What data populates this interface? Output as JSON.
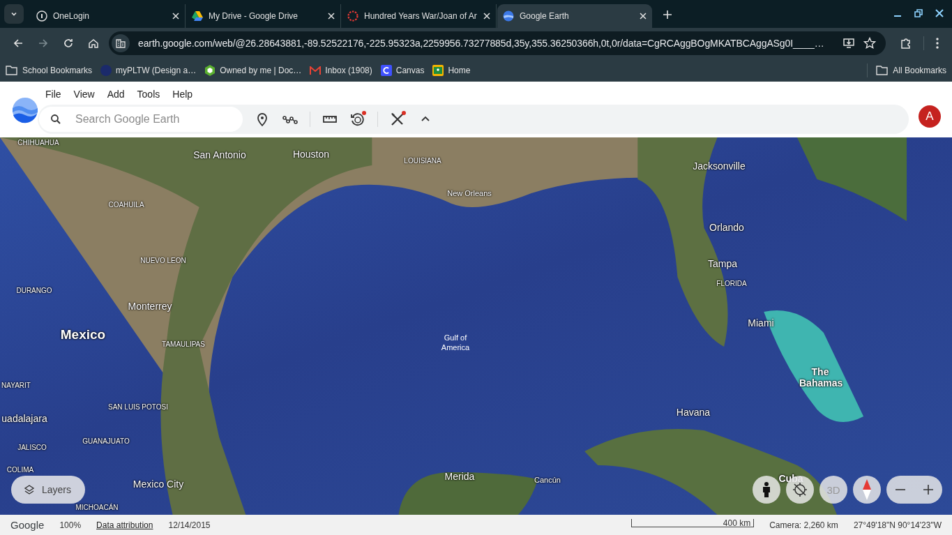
{
  "browser": {
    "tabs": [
      {
        "title": "OneLogin",
        "selected": false
      },
      {
        "title": "My Drive - Google Drive",
        "selected": false
      },
      {
        "title": "Hundred Years War/Joan of Ar",
        "selected": false
      },
      {
        "title": "Google Earth",
        "selected": true
      }
    ],
    "address": "earth.google.com/web/@26.28643881,-89.52522176,-225.95323a,2259956.73277885d,35y,355.36250366h,0t,0r/data=CgRCAggBOgMKATBCAggASg0I____…",
    "bookmarks": [
      {
        "title": "School Bookmarks"
      },
      {
        "title": "myPLTW (Design a…"
      },
      {
        "title": "Owned by me | Doc…"
      },
      {
        "title": "Inbox (1908)"
      },
      {
        "title": "Canvas"
      },
      {
        "title": "Home"
      }
    ],
    "all_bookmarks": "All Bookmarks"
  },
  "app": {
    "menu": [
      "File",
      "View",
      "Add",
      "Tools",
      "Help"
    ],
    "search": {
      "placeholder": "Search Google Earth"
    },
    "tools": [
      {
        "kind": "pin",
        "notification": false
      },
      {
        "kind": "path",
        "notification": false
      },
      {
        "kind": "ruler",
        "notification": false
      },
      {
        "kind": "history",
        "notification": true
      },
      {
        "kind": "tools",
        "notification": true
      },
      {
        "kind": "collapse",
        "notification": false
      }
    ],
    "avatar": "A"
  },
  "map": {
    "labels": [
      {
        "text": "CHIHUAHUA",
        "kind": "region"
      },
      {
        "text": "San Antonio",
        "kind": "city"
      },
      {
        "text": "Houston",
        "kind": "city"
      },
      {
        "text": "LOUISIANA",
        "kind": "region"
      },
      {
        "text": "Jacksonville",
        "kind": "city"
      },
      {
        "text": "COAHUILA",
        "kind": "region"
      },
      {
        "text": "New Orleans",
        "kind": "small"
      },
      {
        "text": "Orlando",
        "kind": "city"
      },
      {
        "text": "NUEVO LEON",
        "kind": "region"
      },
      {
        "text": "Tampa",
        "kind": "city"
      },
      {
        "text": "DURANGO",
        "kind": "region"
      },
      {
        "text": "FLORIDA",
        "kind": "region"
      },
      {
        "text": "Monterrey",
        "kind": "city"
      },
      {
        "text": "Miami",
        "kind": "city"
      },
      {
        "text": "Mexico",
        "kind": "country"
      },
      {
        "text": "TAMAULIPAS",
        "kind": "region"
      },
      {
        "text": "Gulf of America",
        "kind": "water"
      },
      {
        "text": "NAYARIT",
        "kind": "region"
      },
      {
        "text": "The Bahamas",
        "kind": "country2"
      },
      {
        "text": "SAN LUIS POTOSI",
        "kind": "region"
      },
      {
        "text": "uadalajara",
        "kind": "city"
      },
      {
        "text": "Havana",
        "kind": "city"
      },
      {
        "text": "JALISCO",
        "kind": "region"
      },
      {
        "text": "GUANAJUATO",
        "kind": "region"
      },
      {
        "text": "Merida",
        "kind": "city"
      },
      {
        "text": "Cancún",
        "kind": "small"
      },
      {
        "text": "Cuba",
        "kind": "country2"
      },
      {
        "text": "COLIMA",
        "kind": "region"
      },
      {
        "text": "Mexico City",
        "kind": "city"
      },
      {
        "text": "MICHOACÁN",
        "kind": "region"
      }
    ],
    "layers_button": "Layers",
    "controls": [
      {
        "kind": "pegman"
      },
      {
        "kind": "north"
      },
      {
        "kind": "threed",
        "label": "3D"
      },
      {
        "kind": "compass"
      },
      {
        "kind": "zoom"
      }
    ]
  },
  "status_bar": {
    "logo": "Google",
    "zoom": "100%",
    "attribution": "Data attribution",
    "date": "12/14/2015",
    "scale": "400 km",
    "camera": "Camera: 2,260 km",
    "coordinates": "27°49'18\"N 90°14'23\"W"
  }
}
